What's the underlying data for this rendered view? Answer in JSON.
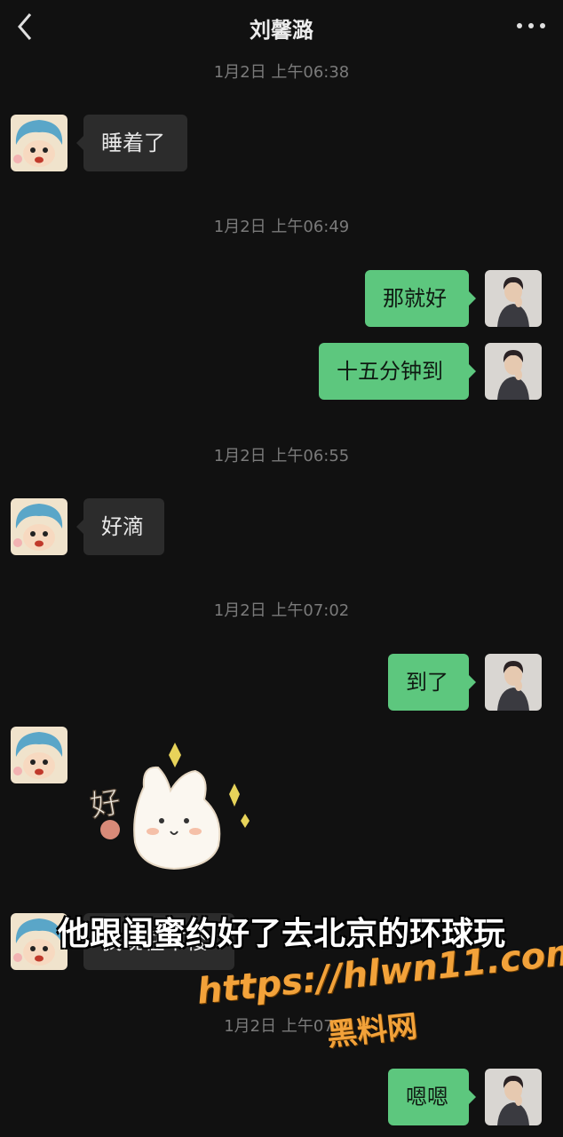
{
  "header": {
    "title": "刘馨潞",
    "back_icon": "chevron-left-icon",
    "more_icon": "more-horizontal-icon"
  },
  "timestamps": [
    "1月2日 上午06:38",
    "1月2日 上午06:49",
    "1月2日 上午06:55",
    "1月2日 上午07:02",
    "1月2日 上午07:"
  ],
  "messages": [
    {
      "side": "in",
      "text": "睡着了"
    },
    {
      "side": "out",
      "text": "那就好"
    },
    {
      "side": "out",
      "text": "十五分钟到"
    },
    {
      "side": "in",
      "text": "好滴"
    },
    {
      "side": "out",
      "text": "到了"
    },
    {
      "side": "in",
      "text": "[sticker]",
      "sticker_text": "好"
    },
    {
      "side": "in",
      "text": "我现在下楼"
    },
    {
      "side": "out",
      "text": "嗯嗯"
    }
  ],
  "overlay": {
    "subtitle": "他跟闺蜜约好了去北京的环球玩",
    "watermark_url": "https://hlwn11.com",
    "watermark_name": "黑料网"
  },
  "colors": {
    "background": "#111111",
    "bubble_in": "#2c2c2c",
    "bubble_out": "#5dc77e",
    "watermark": "#f2a23a"
  }
}
